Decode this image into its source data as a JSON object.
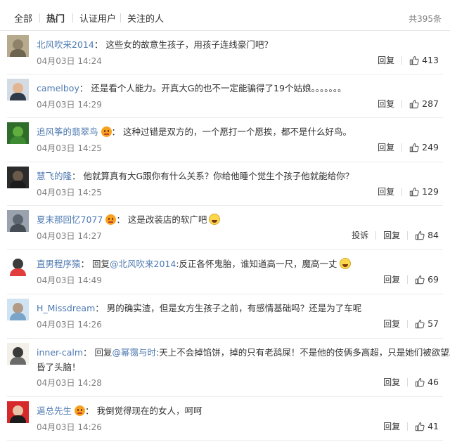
{
  "tabs": [
    "全部",
    "热门",
    "认证用户",
    "关注的人"
  ],
  "active_tab": 1,
  "total_count": "共395条",
  "actions": {
    "reply": "回复",
    "report": "投诉"
  },
  "colors": {
    "link": "#4e7ab1",
    "meta": "#808080",
    "vip": "#f7a120"
  },
  "comments": [
    {
      "username": "北风吹来2014",
      "vip": false,
      "reply_prefix": "",
      "mention": "",
      "separator": "：",
      "text": "这些女的故意生孩子，用孩子连线豪门吧？",
      "text2": "",
      "emoji": false,
      "date": "04月03日 14:24",
      "likes": "413",
      "has_report": false,
      "avatar": {
        "icon": "landscape-photo-avatar",
        "bg": "#b7ab8d",
        "face": "#8f826a",
        "body": "#6d644f"
      }
    },
    {
      "username": "camelboy",
      "vip": false,
      "reply_prefix": "",
      "mention": "",
      "separator": "：",
      "text": "还是看个人能力。开真大G的也不一定能骗得了19个姑娘。。。。。。。",
      "text2": "",
      "emoji": false,
      "date": "04月03日 14:29",
      "likes": "287",
      "has_report": false,
      "avatar": {
        "icon": "man-with-glasses-avatar",
        "bg": "#d5dbe2",
        "face": "#e2b693",
        "body": "#2e3a4a"
      }
    },
    {
      "username": "追风筝的翡翠鸟",
      "vip": true,
      "reply_prefix": "",
      "mention": "",
      "separator": "：",
      "text": "这种过错是双方的，一个愿打一个愿挨，都不是什么好鸟。",
      "text2": "",
      "emoji": false,
      "date": "04月03日 14:25",
      "likes": "249",
      "has_report": false,
      "avatar": {
        "icon": "green-leaf-avatar",
        "bg": "#2f6e2a",
        "face": "#5fae3f",
        "body": "#3f8b34"
      }
    },
    {
      "username": "慧飞的隆",
      "vip": false,
      "reply_prefix": "",
      "mention": "",
      "separator": "：",
      "text": "他就算真有大G跟你有什么关系？你给他睡个觉生个孩子他就能给你？",
      "text2": "",
      "emoji": false,
      "date": "04月03日 14:25",
      "likes": "129",
      "has_report": false,
      "avatar": {
        "icon": "dark-face-avatar",
        "bg": "#2b2b2b",
        "face": "#6b5a4a",
        "body": "#1c1c1c"
      }
    },
    {
      "username": "夏末那回忆7077",
      "vip": true,
      "reply_prefix": "",
      "mention": "",
      "separator": "：",
      "text": "这是改装店的软广吧",
      "text2": "",
      "emoji": true,
      "date": "04月03日 14:27",
      "likes": "84",
      "has_report": true,
      "avatar": {
        "icon": "street-photo-avatar",
        "bg": "#9aa3ad",
        "face": "#5d6670",
        "body": "#464d55"
      }
    },
    {
      "username": "直男程序猿",
      "vip": false,
      "reply_prefix": "回复",
      "mention": "@北风吹来2014",
      "separator": ":",
      "text": "反正各怀鬼胎，谁知道高一尺，魔高一丈",
      "text2": "",
      "emoji": true,
      "date": "04月03日 14:49",
      "likes": "69",
      "has_report": false,
      "avatar": {
        "icon": "husky-dog-avatar",
        "bg": "#ffffff",
        "face": "#3c3c3c",
        "body": "#e23c3c"
      }
    },
    {
      "username": "H_Missdream",
      "vip": false,
      "reply_prefix": "",
      "mention": "",
      "separator": "：",
      "text": "男的确实渣，但是女方生孩子之前，有感情基础吗？还是为了车呢",
      "text2": "",
      "emoji": false,
      "date": "04月03日 14:26",
      "likes": "57",
      "has_report": false,
      "avatar": {
        "icon": "sky-photo-avatar",
        "bg": "#cfe3f2",
        "face": "#b39a86",
        "body": "#7aa4c8"
      }
    },
    {
      "username": "inner-calm",
      "vip": false,
      "reply_prefix": "回复",
      "mention": "@幂霭与时",
      "separator": ":",
      "text": "天上不会掉馅饼，掉的只有老鸹屎！不是他的伎俩多高超，只是她们被欲望冲",
      "text2": "昏了头脑！",
      "emoji": false,
      "date": "04月03日 14:28",
      "likes": "46",
      "has_report": false,
      "avatar": {
        "icon": "calligraphy-avatar",
        "bg": "#f3f0e9",
        "face": "#3a3a3a",
        "body": "#6a6a6a"
      }
    },
    {
      "username": "逼总先生",
      "vip": true,
      "reply_prefix": "",
      "mention": "",
      "separator": "：",
      "text": "我倒觉得现在的女人，呵呵",
      "text2": "",
      "emoji": false,
      "date": "04月03日 14:26",
      "likes": "41",
      "has_report": false,
      "avatar": {
        "icon": "man-red-background-avatar",
        "bg": "#d62a2a",
        "face": "#e7c4a6",
        "body": "#1c1c1c"
      }
    }
  ]
}
